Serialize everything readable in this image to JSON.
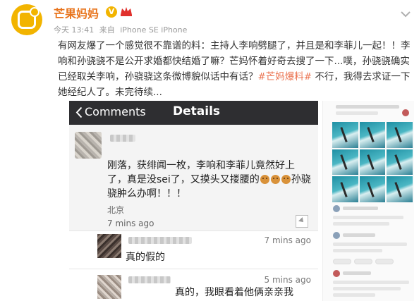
{
  "post": {
    "user_name": "芒果妈妈",
    "verified_mark": "V",
    "meta": {
      "time": "今天 13:41",
      "source_prefix": "来自",
      "device": "iPhone SE iPhone"
    },
    "body_part1": "有网友爆了一个感觉很不靠谱的料：主持人李响劈腿了，并且是和李菲儿一起！！李响和孙骁骁不是公开求婚都快结婚了嘛？芒妈怀着好奇去搜了一下...噗，孙骁骁确实已经取关李响，孙骁骁这条微博貌似话中有话？",
    "hashtag": "#芒妈爆料#",
    "body_part2": " 不行，我得去求证一下她经纪人了。未完待续..."
  },
  "screenshot": {
    "nav": {
      "back_label": "Comments",
      "title": "Details"
    },
    "main_comment": {
      "text_part1": "刚落，获绯闻一枚，李响和李菲儿竟然好上了，真是没sei了，又摸头又搂腰的",
      "text_part2": "孙骁骁肿么办啊！！！",
      "location": "北京",
      "time": "7 mins ago"
    },
    "replies": [
      {
        "text": "真的假的",
        "time": "7 mins ago"
      },
      {
        "text": "真的，我眼看着他俩亲亲我",
        "time": "5 mins ago"
      }
    ]
  },
  "colors": {
    "username": "#e8741c",
    "hashtag": "#eb7350",
    "nav_bar": "#2e2e31",
    "avatar_bg": "#f2b400"
  },
  "icons": [
    "app-logo-icon",
    "verified-icon",
    "crown-icon",
    "chevron-down-icon",
    "back-chevron-icon",
    "emoji-icon",
    "more-icon"
  ]
}
